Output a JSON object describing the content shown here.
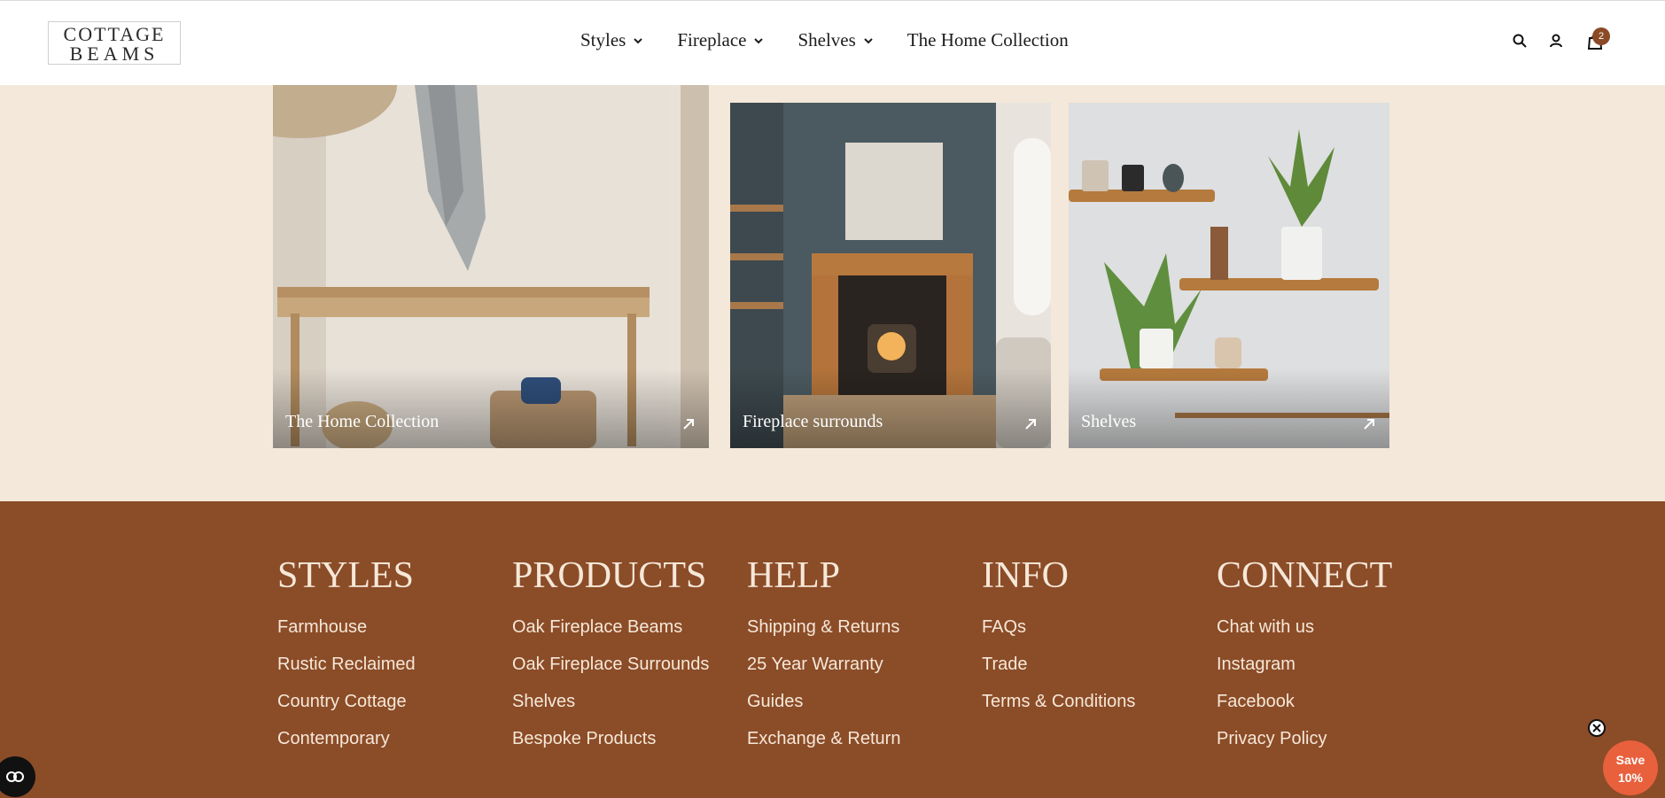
{
  "brand": {
    "line1": "COTTAGE",
    "line2": "BEAMS"
  },
  "nav": {
    "items": [
      {
        "label": "Styles",
        "has_dropdown": true
      },
      {
        "label": "Fireplace",
        "has_dropdown": true
      },
      {
        "label": "Shelves",
        "has_dropdown": true
      },
      {
        "label": "The Home Collection",
        "has_dropdown": false
      }
    ]
  },
  "header_icons": {
    "search": "search-icon",
    "account": "user-icon",
    "cart": "cart-icon",
    "cart_count": "2"
  },
  "cards": [
    {
      "label": "The Home Collection",
      "icon": "arrow-up-right-icon"
    },
    {
      "label": "Fireplace surrounds",
      "icon": "arrow-up-right-icon"
    },
    {
      "label": "Shelves",
      "icon": "arrow-up-right-icon"
    }
  ],
  "footer": {
    "columns": [
      {
        "heading": "STYLES",
        "links": [
          "Farmhouse",
          "Rustic Reclaimed",
          "Country Cottage",
          "Contemporary"
        ]
      },
      {
        "heading": "PRODUCTS",
        "links": [
          "Oak Fireplace Beams",
          "Oak Fireplace Surrounds",
          "Shelves",
          "Bespoke Products"
        ]
      },
      {
        "heading": "HELP",
        "links": [
          "Shipping & Returns",
          "25 Year Warranty",
          "Guides",
          "Exchange & Return"
        ]
      },
      {
        "heading": "INFO",
        "links": [
          "FAQs",
          "Trade",
          "Terms & Conditions"
        ]
      },
      {
        "heading": "CONNECT",
        "links": [
          "Chat with us",
          "Instagram",
          "Facebook",
          "Privacy Policy"
        ]
      }
    ]
  },
  "save_popup": {
    "line1": "Save",
    "line2": "10%"
  },
  "colors": {
    "footer_bg": "#8b4c28",
    "page_bg": "#f4e8da",
    "badge": "#8a4a26",
    "save": "#e8603c"
  }
}
